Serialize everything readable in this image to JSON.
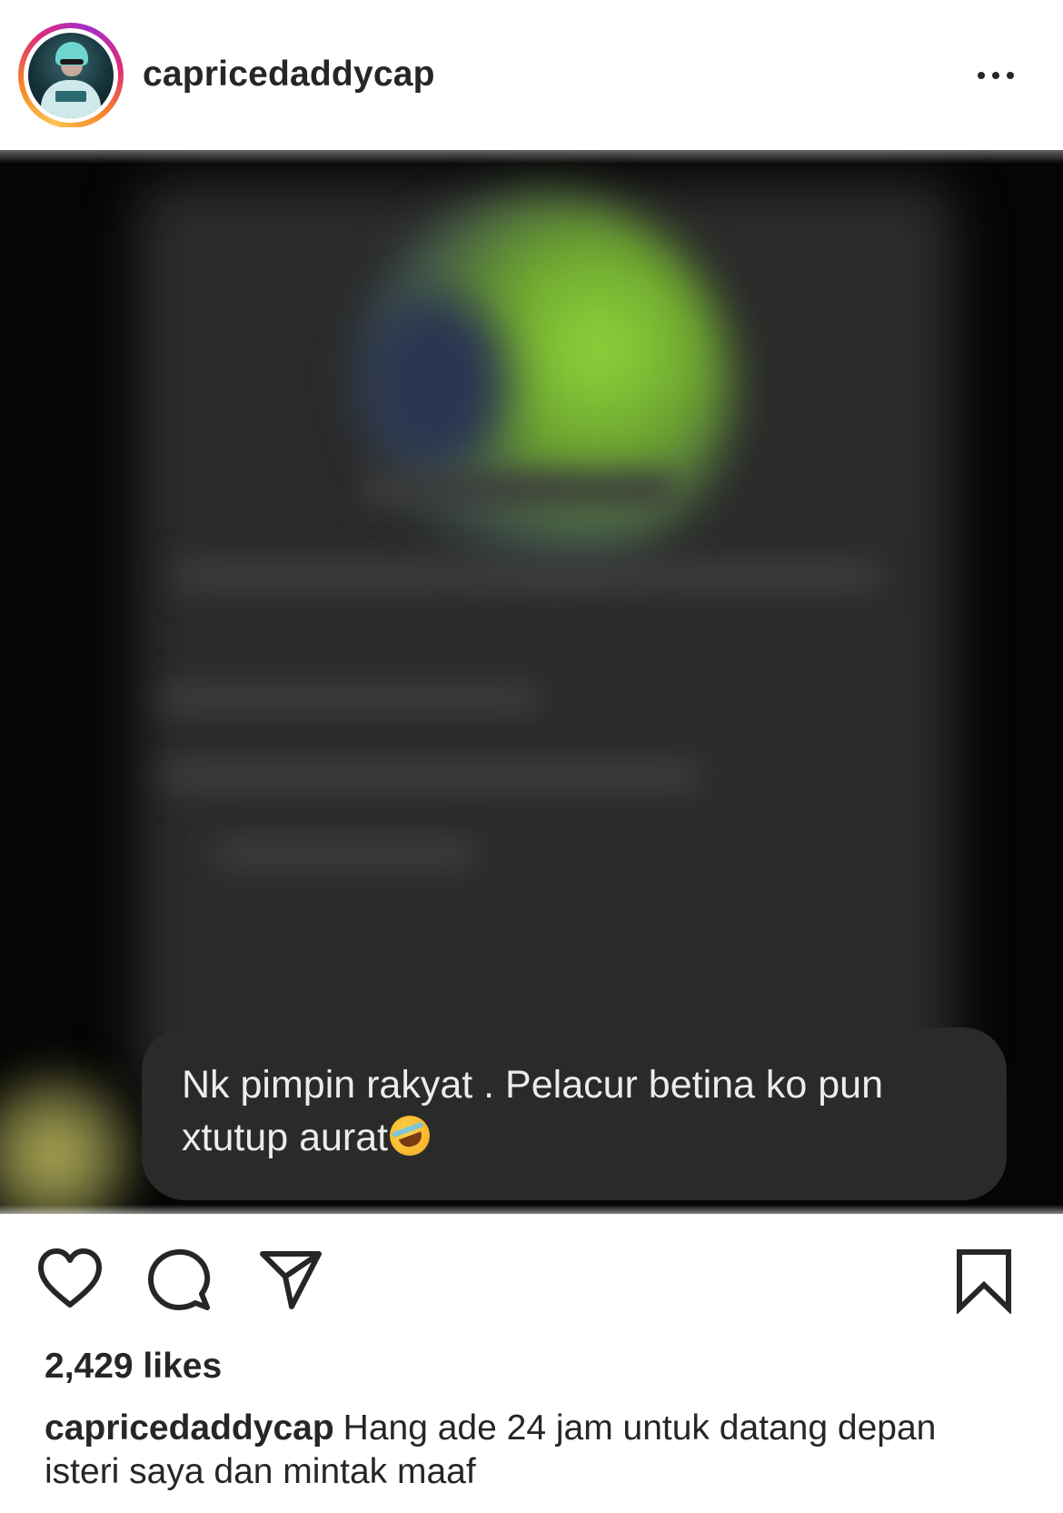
{
  "post": {
    "username": "capricedaddycap",
    "more_options_icon": "ellipsis-horizontal-icon",
    "avatar_icon": "profile-photo",
    "story_ring_colors": [
      "#fdc34f",
      "#f58529",
      "#dd2a7b",
      "#a32fc9"
    ],
    "media": {
      "background": "#050505",
      "comment_text": "Nk pimpin rakyat . Pelacur betina ko pun\nxtutup aurat",
      "comment_emoji": "rolling-on-the-floor-laughing-emoji"
    },
    "actions": {
      "like_icon": "heart-outline-icon",
      "comment_icon": "comment-bubble-icon",
      "share_icon": "paper-plane-icon",
      "save_icon": "bookmark-outline-icon"
    },
    "likes_text": "2,429 likes",
    "caption": {
      "username": "capricedaddycap",
      "text": "Hang ade 24 jam untuk datang depan isteri saya dan mintak maaf"
    }
  }
}
